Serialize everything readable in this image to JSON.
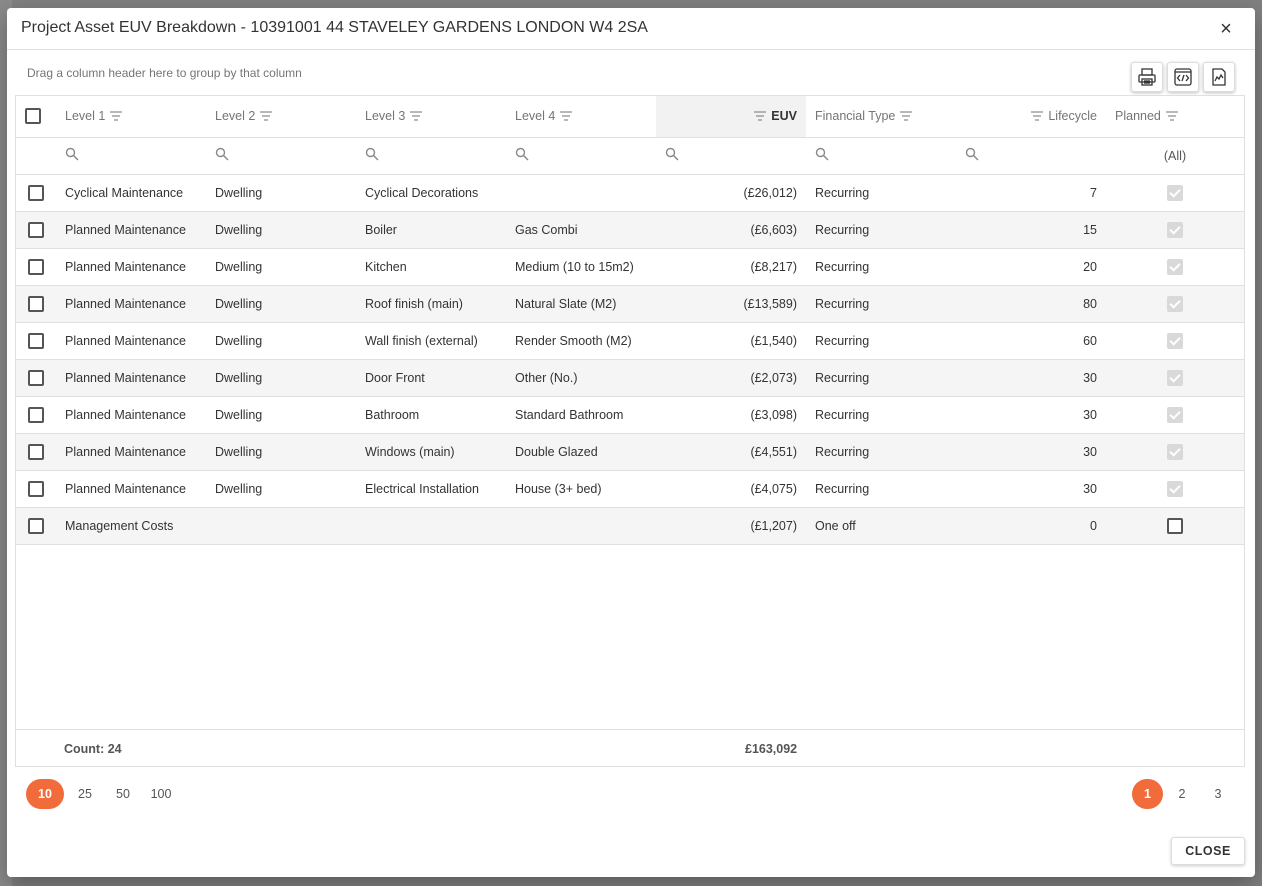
{
  "dialog": {
    "title": "Project Asset EUV Breakdown - 10391001 44 STAVELEY GARDENS LONDON W4 2SA",
    "close_glyph": "×"
  },
  "group_panel": {
    "text": "Drag a column header here to group by that column"
  },
  "toolbar": {
    "icons": [
      "print-icon",
      "export-html-icon",
      "export-chart-icon"
    ]
  },
  "columns": {
    "level1": "Level 1",
    "level2": "Level 2",
    "level3": "Level 3",
    "level4": "Level 4",
    "euv": "EUV",
    "financial_type": "Financial Type",
    "lifecycle": "Lifecycle",
    "planned": "Planned"
  },
  "filter_row": {
    "planned_value": "(All)"
  },
  "rows": [
    {
      "level1": "Cyclical Maintenance",
      "level2": "Dwelling",
      "level3": "Cyclical Decorations",
      "level4": "",
      "euv": "(£26,012)",
      "financial_type": "Recurring",
      "lifecycle": "7",
      "planned": true
    },
    {
      "level1": "Planned Maintenance",
      "level2": "Dwelling",
      "level3": "Boiler",
      "level4": "Gas Combi",
      "euv": "(£6,603)",
      "financial_type": "Recurring",
      "lifecycle": "15",
      "planned": true
    },
    {
      "level1": "Planned Maintenance",
      "level2": "Dwelling",
      "level3": "Kitchen",
      "level4": "Medium (10 to 15m2)",
      "euv": "(£8,217)",
      "financial_type": "Recurring",
      "lifecycle": "20",
      "planned": true
    },
    {
      "level1": "Planned Maintenance",
      "level2": "Dwelling",
      "level3": "Roof finish (main)",
      "level4": "Natural Slate (M2)",
      "euv": "(£13,589)",
      "financial_type": "Recurring",
      "lifecycle": "80",
      "planned": true
    },
    {
      "level1": "Planned Maintenance",
      "level2": "Dwelling",
      "level3": "Wall finish (external)",
      "level4": "Render Smooth (M2)",
      "euv": "(£1,540)",
      "financial_type": "Recurring",
      "lifecycle": "60",
      "planned": true
    },
    {
      "level1": "Planned Maintenance",
      "level2": "Dwelling",
      "level3": "Door Front",
      "level4": "Other (No.)",
      "euv": "(£2,073)",
      "financial_type": "Recurring",
      "lifecycle": "30",
      "planned": true
    },
    {
      "level1": "Planned Maintenance",
      "level2": "Dwelling",
      "level3": "Bathroom",
      "level4": "Standard Bathroom",
      "euv": "(£3,098)",
      "financial_type": "Recurring",
      "lifecycle": "30",
      "planned": true
    },
    {
      "level1": "Planned Maintenance",
      "level2": "Dwelling",
      "level3": "Windows (main)",
      "level4": "Double Glazed",
      "euv": "(£4,551)",
      "financial_type": "Recurring",
      "lifecycle": "30",
      "planned": true
    },
    {
      "level1": "Planned Maintenance",
      "level2": "Dwelling",
      "level3": "Electrical Installation",
      "level4": "House (3+ bed)",
      "euv": "(£4,075)",
      "financial_type": "Recurring",
      "lifecycle": "30",
      "planned": true
    },
    {
      "level1": "Management Costs",
      "level2": "",
      "level3": "",
      "level4": "",
      "euv": "(£1,207)",
      "financial_type": "One off",
      "lifecycle": "0",
      "planned": false
    }
  ],
  "summary": {
    "count": "Count: 24",
    "total": "£163,092"
  },
  "page_sizes": [
    "10",
    "25",
    "50",
    "100"
  ],
  "pages": [
    "1",
    "2",
    "3"
  ],
  "footer": {
    "close_label": "CLOSE"
  },
  "colors": {
    "accent": "#f26b3a"
  }
}
